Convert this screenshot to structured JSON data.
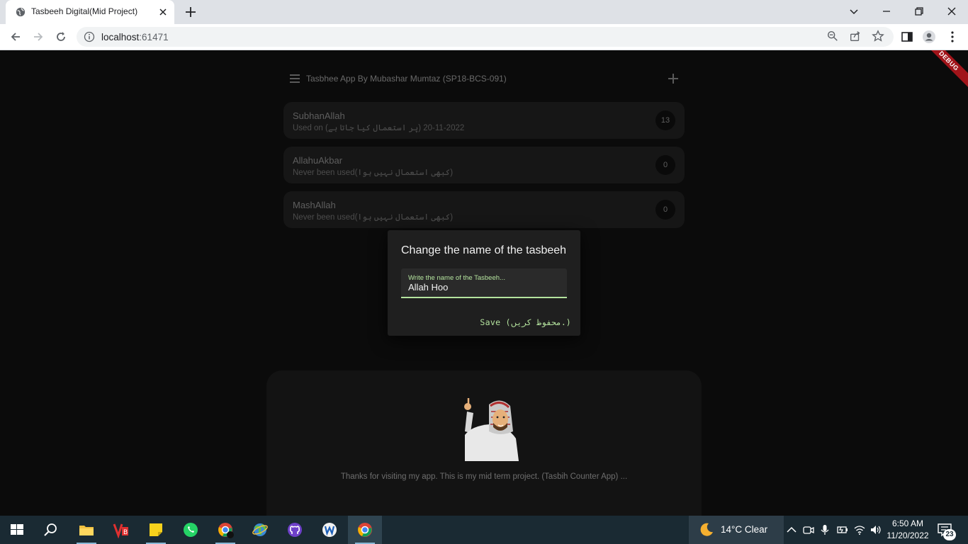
{
  "browser": {
    "tab_title": "Tasbeeh Digital(Mid Project)",
    "url_host": "localhost",
    "url_port": ":61471"
  },
  "app": {
    "debug_label": "DEBUG",
    "title": "Tasbhee App By Mubashar Mumtaz (SP18-BCS-091)",
    "items": [
      {
        "name": "SubhanAllah",
        "subtitle": "Used on (پر استعمال کیا جاتا ہے) 2022-11-20",
        "count": "13"
      },
      {
        "name": "AllahuAkbar",
        "subtitle": "Never been used(کبھی استعمال نہیں ہوا)",
        "count": "0"
      },
      {
        "name": "MashAllah",
        "subtitle": "Never been used(کبھی استعمال نہیں ہوا)",
        "count": "0"
      }
    ],
    "dialog": {
      "title": "Change the name of the tasbeeh",
      "field_label": "Write the name of the Tasbeeh...",
      "field_value": "Allah Hoo",
      "save_label": "Save (محفوظ کریں.)"
    },
    "footer_text": "Thanks for visiting my app. This is my mid term project. (Tasbih Counter App) ..."
  },
  "taskbar": {
    "weather": "14°C  Clear",
    "time": "6:50 AM",
    "date": "11/20/2022",
    "notification_count": "23"
  },
  "colors": {
    "accent_green": "#b4e39e",
    "debug_red": "#a1141a",
    "background": "#0b0b0b"
  }
}
